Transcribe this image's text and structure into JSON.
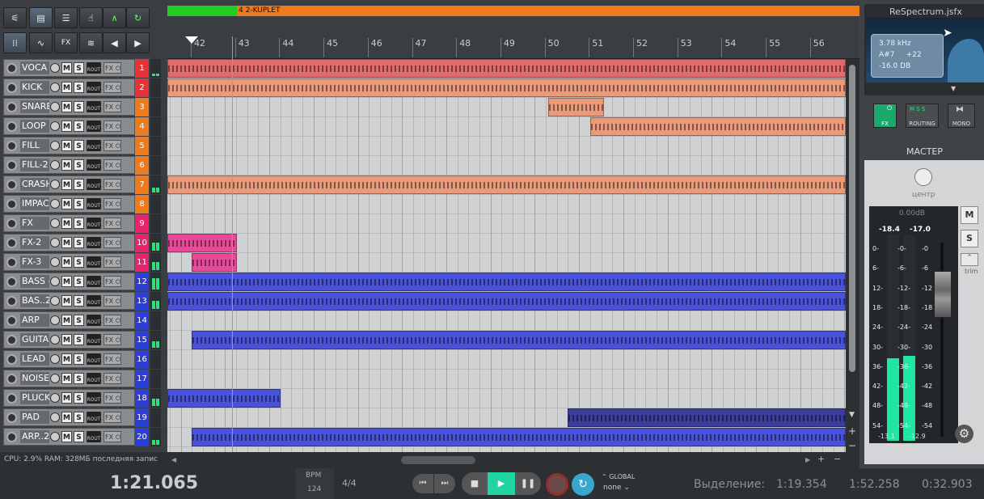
{
  "toolbar": {
    "icons": [
      "mixer-icon",
      "save-icon",
      "list-icon",
      "touch-icon",
      "trim-icon",
      "loop-icon",
      "grid-icon",
      "envelope-icon",
      "fx-icon",
      "waves-icon",
      "prev-icon",
      "next-icon"
    ],
    "fx_label": "FX"
  },
  "regions": {
    "region_num": "4",
    "region_name": "2-KUPLET"
  },
  "ruler": {
    "bars": [
      "42",
      "43",
      "44",
      "45",
      "46",
      "47",
      "48",
      "49",
      "50",
      "51",
      "52",
      "53",
      "54",
      "55",
      "56"
    ]
  },
  "tracks": [
    {
      "name": "VOCA",
      "num": "1",
      "color": "#e8323a"
    },
    {
      "name": "KICK",
      "num": "2",
      "color": "#e8323a"
    },
    {
      "name": "SNARE",
      "num": "3",
      "color": "#ee7a1e"
    },
    {
      "name": "LOOP",
      "num": "4",
      "color": "#ee7a1e"
    },
    {
      "name": "FILL",
      "num": "5",
      "color": "#ee7a1e"
    },
    {
      "name": "FILL-2",
      "num": "6",
      "color": "#ee7a1e"
    },
    {
      "name": "CRASH",
      "num": "7",
      "color": "#ee7a1e"
    },
    {
      "name": "IMPAC",
      "num": "8",
      "color": "#ee7a1e"
    },
    {
      "name": "FX",
      "num": "9",
      "color": "#e8236b"
    },
    {
      "name": "FX-2",
      "num": "10",
      "color": "#e8236b"
    },
    {
      "name": "FX-3",
      "num": "11",
      "color": "#e8236b"
    },
    {
      "name": "BASS -",
      "num": "12",
      "color": "#2b3ed8"
    },
    {
      "name": "BAS..2",
      "num": "13",
      "color": "#2b3ed8"
    },
    {
      "name": "ARP",
      "num": "14",
      "color": "#2b3ed8"
    },
    {
      "name": "GUITA",
      "num": "15",
      "color": "#2b3ed8"
    },
    {
      "name": "LEAD",
      "num": "16",
      "color": "#2b3ed8"
    },
    {
      "name": "NOISE",
      "num": "17",
      "color": "#2b3ed8"
    },
    {
      "name": "PLUCK",
      "num": "18",
      "color": "#2b3ed8"
    },
    {
      "name": "PAD",
      "num": "19",
      "color": "#2b3ed8"
    },
    {
      "name": "ARP..2",
      "num": "20",
      "color": "#2b3ed8"
    }
  ],
  "track_buttons": {
    "mute": "M",
    "solo": "S",
    "rout": "ROUT",
    "fx": "FX"
  },
  "status": {
    "text": "CPU: 2.9% RAM: 328МБ последняя запис"
  },
  "transport": {
    "time": "1:21.065",
    "bpm_label": "BPM",
    "bpm": "124",
    "signature": "4/4",
    "global_label": "GLOBAL",
    "global_value": "none",
    "selection_label": "Выделение:",
    "sel_start": "1:19.354",
    "sel_end": "1:52.258",
    "sel_len": "0:32.903"
  },
  "plugin": {
    "title": "ReSpectrum.jsfx",
    "freq": "3.78 kHz",
    "note": "A#7",
    "cents": "+22",
    "db": "-16.0 DB"
  },
  "master": {
    "fx": "FX",
    "routing": "ROUTING",
    "mono": "MONO",
    "title": "МАСТЕР",
    "pan": "центр",
    "vol": "0.00dB",
    "peak_l": "-18.4",
    "peak_r": "-17.0",
    "mute": "M",
    "solo": "S",
    "trim": "trim",
    "bottom_l": "-13.1",
    "bottom_r": "-12.9",
    "level_l": 0.4,
    "level_r": 0.41
  },
  "scale_left": [
    "0-",
    "6-",
    "12-",
    "18-",
    "24-",
    "30-",
    "36-",
    "42-",
    "48-",
    "54-"
  ],
  "scale_mid": [
    "-0-",
    "-6-",
    "-12-",
    "-18-",
    "-24-",
    "-30-",
    "-36-",
    "-42-",
    "-48-",
    "-54-"
  ],
  "scale_right": [
    "-0",
    "-6",
    "-12",
    "-18",
    "-24",
    "-30",
    "-36",
    "-42",
    "-48",
    "-54"
  ]
}
